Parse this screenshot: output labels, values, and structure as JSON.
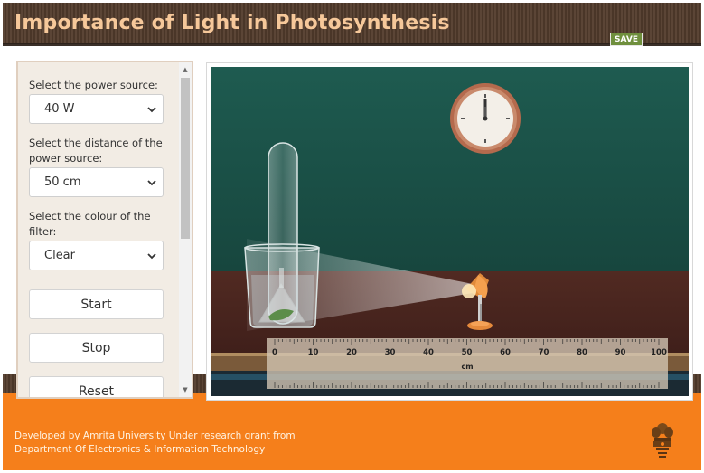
{
  "app": {
    "title": "Importance of Light in Photosynthesis",
    "save_label": "SAVE"
  },
  "controls": {
    "power_source": {
      "label": "Select the power source:",
      "value": "40 W"
    },
    "distance": {
      "label": "Select the distance of the power source:",
      "value": "50 cm"
    },
    "filter": {
      "label": "Select the colour of the filter:",
      "value": "Clear"
    },
    "start_label": "Start",
    "stop_label": "Stop",
    "reset_label": "Reset"
  },
  "ruler": {
    "unit": "cm",
    "ticks": [
      "0",
      "10",
      "20",
      "30",
      "40",
      "50",
      "60",
      "70",
      "80",
      "90",
      "100"
    ]
  },
  "footer": {
    "line1": "Developed by Amrita University Under research grant from",
    "line2": "Department Of Electronics & Information Technology"
  },
  "colors": {
    "header_text": "#f6c89a",
    "save_bg": "#6f8f3d",
    "footer_bg": "#f57f1b",
    "wall": "#1f5a4f",
    "table": "#4c2620"
  },
  "icons": {
    "select_arrow": "chevron-down-icon",
    "clock": "clock-icon",
    "lamp": "lamp-icon",
    "emblem": "national-emblem-icon"
  }
}
